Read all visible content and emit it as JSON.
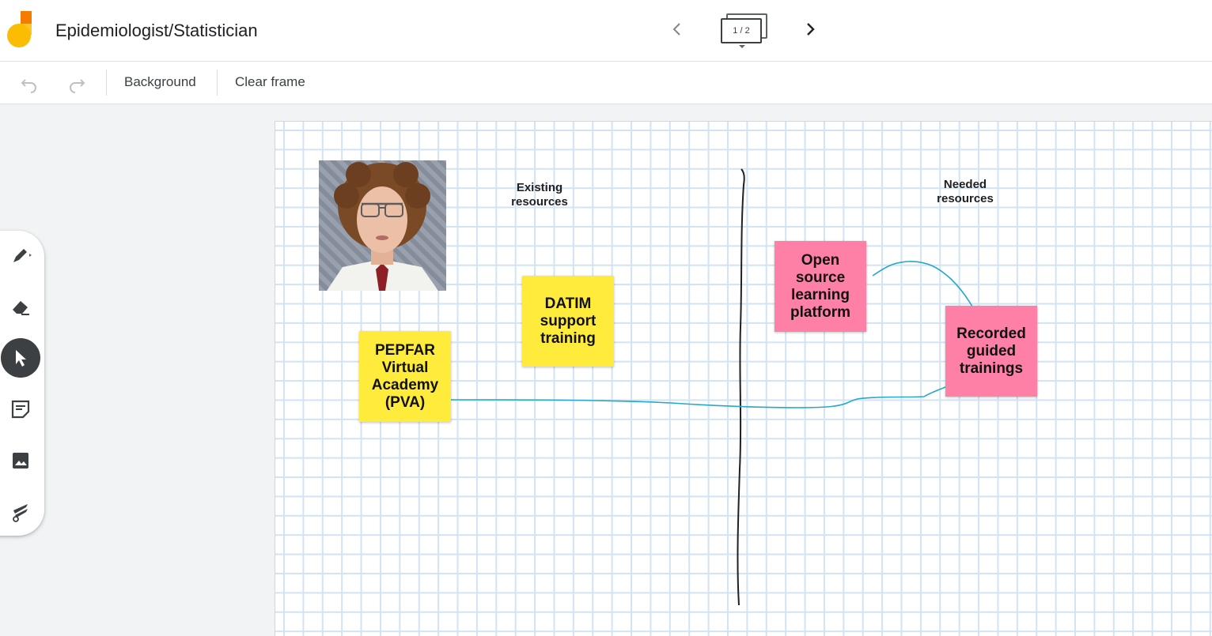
{
  "header": {
    "title": "Epidemiologist/Statistician",
    "frame_indicator": "1 / 2"
  },
  "toolbar": {
    "background_label": "Background",
    "clear_frame_label": "Clear frame"
  },
  "rail": {
    "tools": [
      "pen-tool",
      "eraser-tool",
      "select-tool",
      "sticky-note-tool",
      "add-image-tool",
      "laser-tool"
    ],
    "active_tool": "select-tool"
  },
  "canvas": {
    "labels": {
      "existing": "Existing resources",
      "needed": "Needed resources"
    },
    "stickies": {
      "pepfar": "PEPFAR Virtual Academy (PVA)",
      "datim": "DATIM support training",
      "open_source": "Open source learning platform",
      "recorded": "Recorded guided trainings"
    },
    "colors": {
      "yellow_note": "#ffeb3b",
      "pink_note": "#ff80a6",
      "connector": "#26a9c8",
      "divider": "#202124"
    }
  }
}
